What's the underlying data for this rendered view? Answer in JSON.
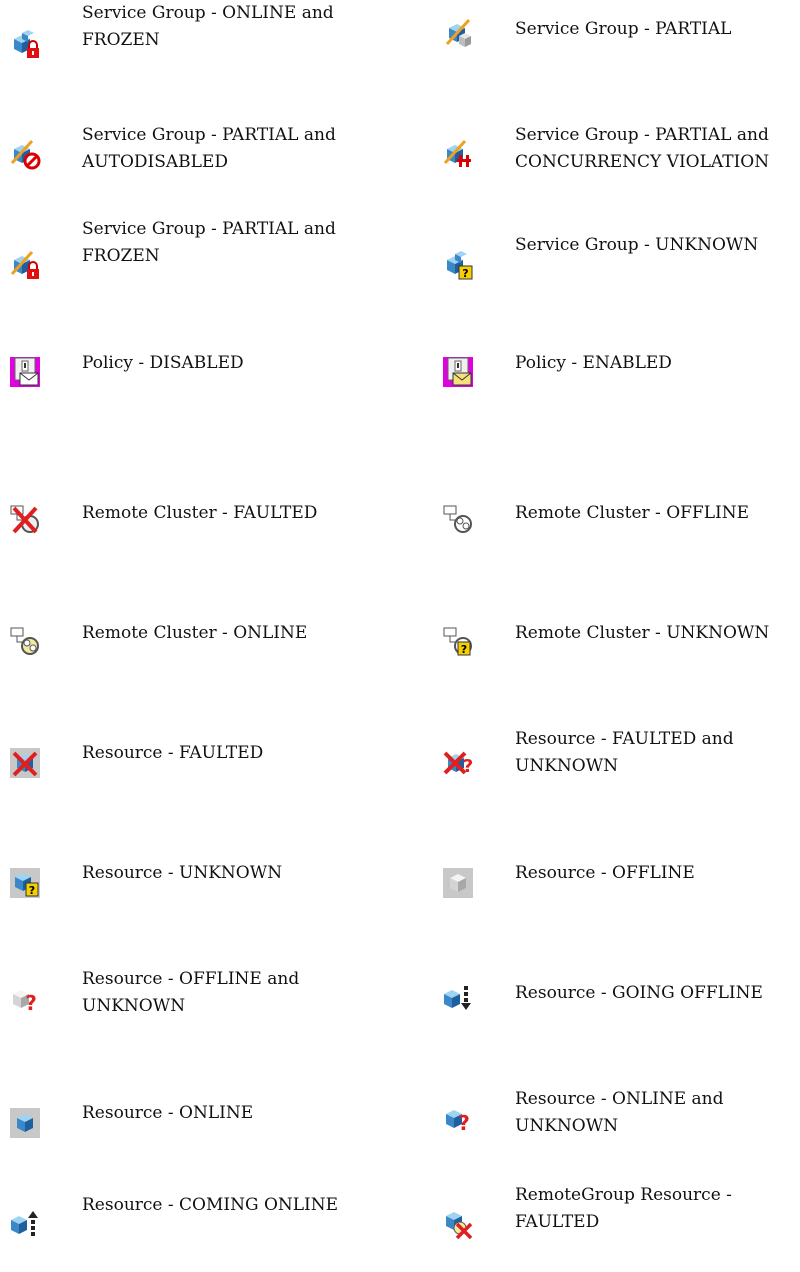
{
  "rows": [
    {
      "left": {
        "label": "Service Group - ONLINE and FROZEN",
        "icon": "sg-online-frozen-icon"
      },
      "right": {
        "label": "Service Group - PARTIAL",
        "icon": "sg-partial-icon"
      }
    },
    {
      "left": {
        "label": "Service Group - PARTIAL and AUTODISABLED",
        "icon": "sg-partial-autodisabled-icon"
      },
      "right": {
        "label": "Service Group - PARTIAL and CONCURRENCY VIOLATION",
        "icon": "sg-partial-concurrency-icon"
      }
    },
    {
      "left": {
        "label": "Service Group - PARTIAL and FROZEN",
        "icon": "sg-partial-frozen-icon"
      },
      "right": {
        "label": "Service Group - UNKNOWN",
        "icon": "sg-unknown-icon"
      }
    },
    {
      "left": {
        "label": "Policy - DISABLED",
        "icon": "policy-disabled-icon"
      },
      "right": {
        "label": "Policy - ENABLED",
        "icon": "policy-enabled-icon"
      }
    },
    {
      "left": {
        "label": "Remote Cluster - FAULTED",
        "icon": "remote-cluster-faulted-icon"
      },
      "right": {
        "label": "Remote Cluster - OFFLINE",
        "icon": "remote-cluster-offline-icon"
      }
    },
    {
      "left": {
        "label": "Remote Cluster - ONLINE",
        "icon": "remote-cluster-online-icon"
      },
      "right": {
        "label": "Remote Cluster - UNKNOWN",
        "icon": "remote-cluster-unknown-icon"
      }
    },
    {
      "left": {
        "label": "Resource - FAULTED",
        "icon": "resource-faulted-icon"
      },
      "right": {
        "label": "Resource - FAULTED and UNKNOWN",
        "icon": "resource-faulted-unknown-icon"
      }
    },
    {
      "left": {
        "label": "Resource - UNKNOWN",
        "icon": "resource-unknown-icon"
      },
      "right": {
        "label": "Resource - OFFLINE",
        "icon": "resource-offline-icon"
      }
    },
    {
      "left": {
        "label": "Resource - OFFLINE and UNKNOWN",
        "icon": "resource-offline-unknown-icon"
      },
      "right": {
        "label": "Resource - GOING OFFLINE",
        "icon": "resource-going-offline-icon"
      }
    },
    {
      "left": {
        "label": "Resource - ONLINE",
        "icon": "resource-online-icon"
      },
      "right": {
        "label": "Resource - ONLINE and UNKNOWN",
        "icon": "resource-online-unknown-icon"
      }
    },
    {
      "left": {
        "label": "Resource - COMING ONLINE",
        "icon": "resource-coming-online-icon"
      },
      "right": {
        "label": "RemoteGroup Resource - FAULTED",
        "icon": "remotegroup-resource-faulted-icon"
      }
    }
  ]
}
